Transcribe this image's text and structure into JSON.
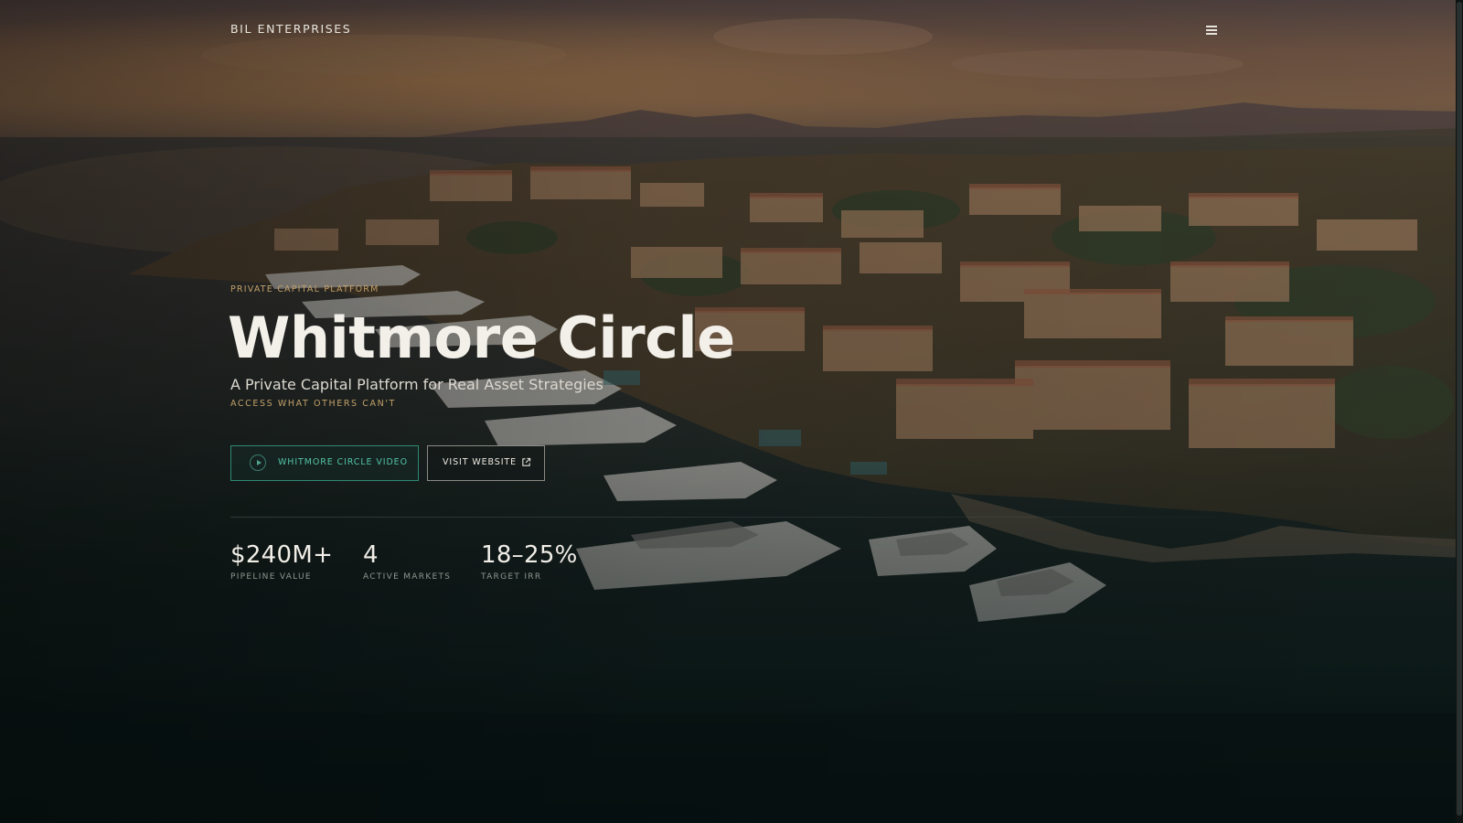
{
  "header": {
    "brand": "BIL ENTERPRISES",
    "menu_icon": "hamburger-menu-icon"
  },
  "hero": {
    "eyebrow": "PRIVATE CAPITAL PLATFORM",
    "title": "Whitmore Circle",
    "subtitle": "A Private Capital Platform for Real Asset Strategies",
    "tagline": "ACCESS WHAT OTHERS CAN'T",
    "video_button": {
      "label": "WHITMORE CIRCLE VIDEO",
      "icon": "play-icon"
    },
    "website_button": {
      "label": "VISIT WEBSITE",
      "icon": "external-link-icon"
    }
  },
  "stats": [
    {
      "value": "$240M+",
      "label": "PIPELINE VALUE"
    },
    {
      "value": "4",
      "label": "ACTIVE MARKETS"
    },
    {
      "value": "18–25%",
      "label": "TARGET IRR"
    }
  ],
  "colors": {
    "accent_gold": "#c2a06a",
    "accent_teal": "#52c3a3",
    "text_primary": "#f3f0ea",
    "background_dark": "#0b1414"
  }
}
